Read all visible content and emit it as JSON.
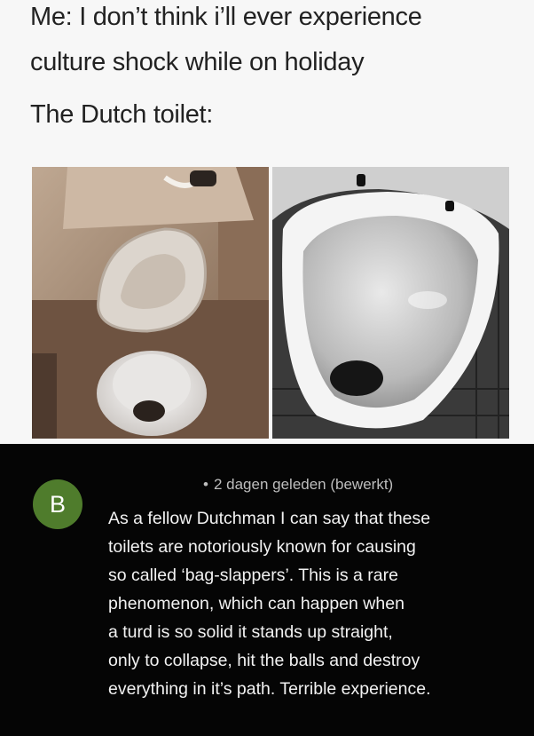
{
  "caption": {
    "line1": "Me: I don’t think i’ll ever experience",
    "line2": "culture shock while on holiday",
    "line3": "The Dutch toilet:"
  },
  "photos": [
    {
      "icon": "toilet-photo-brown-bathroom"
    },
    {
      "icon": "toilet-photo-white-bowl-closeup"
    }
  ],
  "comment": {
    "avatar_letter": "B",
    "avatar_color": "#4f7c2c",
    "meta": "2 dagen geleden (bewerkt)",
    "lines": [
      "As a fellow Dutchman I can say that these",
      "toilets are notoriously known for causing",
      "so called ‘bag-slappers’. This is a rare",
      "phenomenon, which can happen when",
      "a turd is so solid it stands up straight,",
      "only to collapse, hit the balls and destroy",
      "everything in it’s path. Terrible experience."
    ]
  }
}
